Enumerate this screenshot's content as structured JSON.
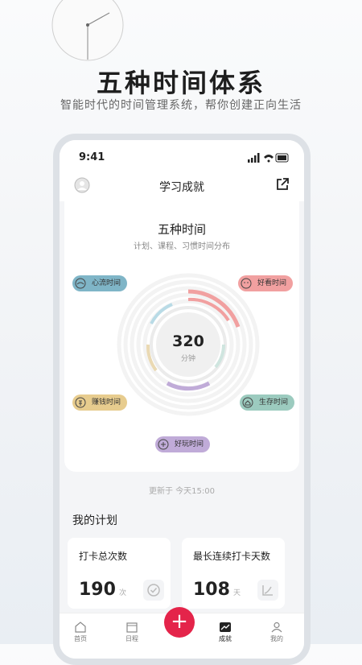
{
  "promo": {
    "title": "五种时间体系",
    "subtitle": "智能时代的时间管理系统，帮你创建正向生活"
  },
  "status_bar": {
    "time": "9:41"
  },
  "nav": {
    "title": "学习成就"
  },
  "summary": {
    "title": "五种时间",
    "subtitle": "计划、课程、习惯时间分布",
    "total_value": "320",
    "total_unit": "分钟"
  },
  "tags": {
    "flow": "心流时间",
    "good": "好看时间",
    "earn": "赚钱时间",
    "live": "生存时间",
    "fun": "好玩时间"
  },
  "updated": "更新于 今天15:00",
  "plan": {
    "section_title": "我的计划",
    "stats": [
      {
        "label": "打卡总次数",
        "value": "190",
        "unit": "次"
      },
      {
        "label": "最长连续打卡天数",
        "value": "108",
        "unit": "天"
      }
    ]
  },
  "tabs": {
    "home": "首页",
    "schedule": "日程",
    "add": "+",
    "achievement": "成就",
    "mine": "我的"
  },
  "colors": {
    "accent": "#e4244a",
    "flow": "#7fb5c7",
    "good": "#f1a0a0",
    "earn": "#e7cc8e",
    "live": "#9ccbbf",
    "fun": "#c0abd8"
  }
}
